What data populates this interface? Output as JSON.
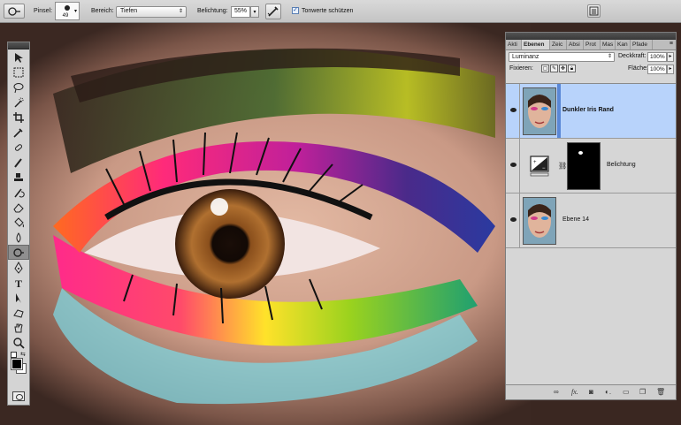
{
  "options_bar": {
    "brush_label": "Pinsel:",
    "brush_size": "49",
    "range_label": "Bereich:",
    "range_value": "Tiefen",
    "exposure_label": "Belichtung:",
    "exposure_value": "55%",
    "protect_tones_label": "Tonwerte schützen",
    "protect_tones_checked": true
  },
  "tools": [
    "move-tool-icon",
    "marquee-tool-icon",
    "lasso-tool-icon",
    "quick-select-tool-icon",
    "crop-tool-icon",
    "eyedropper-tool-icon",
    "spot-healing-tool-icon",
    "brush-tool-icon",
    "clone-stamp-tool-icon",
    "history-brush-tool-icon",
    "eraser-tool-icon",
    "paint-bucket-tool-icon",
    "blur-tool-icon",
    "burn-tool-icon",
    "pen-tool-icon",
    "type-tool-icon",
    "path-select-tool-icon",
    "shape-tool-icon",
    "hand-tool-icon",
    "zoom-tool-icon"
  ],
  "active_tool": "burn-tool-icon",
  "layers_panel": {
    "tabs": [
      "Akti",
      "Ebenen",
      "Zeic",
      "Absi",
      "Prot",
      "Mas",
      "Kan",
      "Pfade"
    ],
    "active_tab": "Ebenen",
    "blend_mode": "Luminanz",
    "opacity_label": "Deckkraft:",
    "opacity_value": "100%",
    "lock_label": "Fixieren:",
    "fill_label": "Fläche:",
    "fill_value": "100%",
    "layers": [
      {
        "name": "Dunkler Iris Rand",
        "selected": true,
        "type": "image"
      },
      {
        "name": "Belichtung",
        "selected": false,
        "type": "adjustment"
      },
      {
        "name": "Ebene 14",
        "selected": false,
        "type": "image"
      }
    ]
  },
  "colors": {
    "selection": "#b8d3fb",
    "foreground": "#000000",
    "background": "#ffffff"
  }
}
